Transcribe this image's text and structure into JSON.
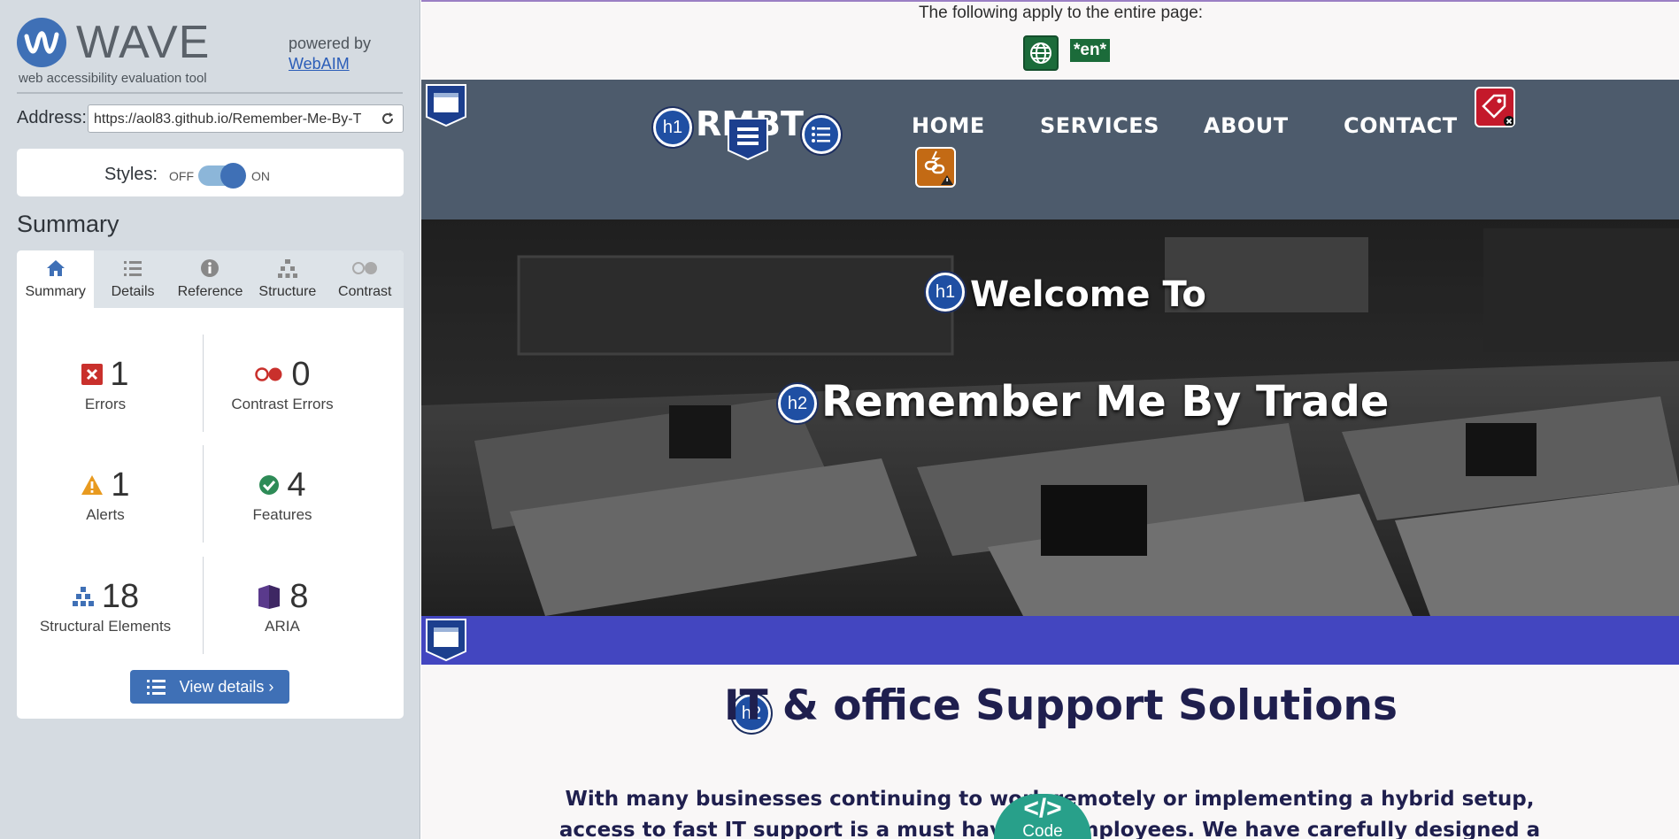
{
  "wave": {
    "logo_text": "WAVE",
    "subtitle": "web accessibility evaluation tool",
    "powered_by": "powered by",
    "webaim_link": "WebAIM",
    "address_label": "Address:",
    "address_value": "https://aol83.github.io/Remember-Me-By-T",
    "styles_label": "Styles:",
    "styles_off": "OFF",
    "styles_on": "ON",
    "summary_heading": "Summary",
    "tabs": [
      {
        "label": "Summary",
        "icon": "home-icon",
        "active": true
      },
      {
        "label": "Details",
        "icon": "list-icon",
        "active": false
      },
      {
        "label": "Reference",
        "icon": "info-icon",
        "active": false
      },
      {
        "label": "Structure",
        "icon": "hierarchy-icon",
        "active": false
      },
      {
        "label": "Contrast",
        "icon": "contrast-icon",
        "active": false
      }
    ],
    "stats": {
      "errors": {
        "count": "1",
        "label": "Errors"
      },
      "contrast_errors": {
        "count": "0",
        "label": "Contrast Errors"
      },
      "alerts": {
        "count": "1",
        "label": "Alerts"
      },
      "features": {
        "count": "4",
        "label": "Features"
      },
      "structural": {
        "count": "18",
        "label": "Structural Elements"
      },
      "aria": {
        "count": "8",
        "label": "ARIA"
      }
    },
    "view_details": "View details ›"
  },
  "page": {
    "top_note": "The following apply to the entire page:",
    "lang_badge": "*en*",
    "brand": "RMBT",
    "nav": [
      "HOME",
      "SERVICES",
      "ABOUT",
      "CONTACT"
    ],
    "hero_h1": "Welcome To",
    "hero_h2": "Remember Me By Trade",
    "section_h2": "IT & office Support Solutions",
    "paragraph": "With many businesses continuing to work remotely or implementing a hybrid setup, access to fast IT support is a must have for employees. We have carefully designed a range of IT",
    "code_button": "Code",
    "code_symbol": "</>",
    "badges": {
      "h1": "h1",
      "h2": "h2"
    }
  },
  "colors": {
    "wave_blue": "#3f70b6",
    "nav_bg": "#4d5b6c",
    "purple_band": "#4346c0",
    "heading_navy": "#1f1f4e",
    "code_teal": "#28a08a"
  }
}
